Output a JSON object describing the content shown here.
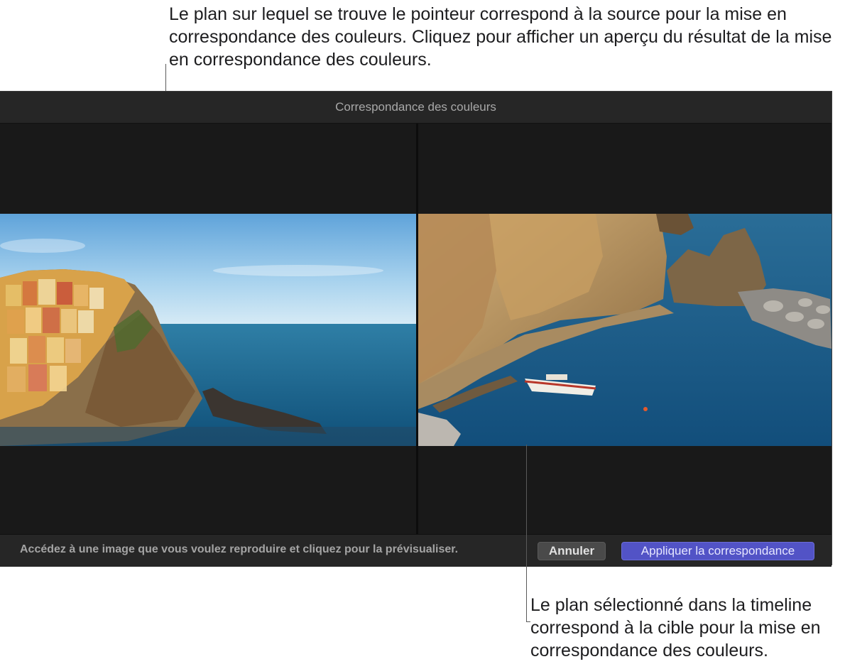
{
  "callouts": {
    "top": "Le plan sur lequel se trouve le pointeur correspond à la source pour la mise en correspondance des couleurs. Cliquez pour afficher un aperçu du résultat de la mise en correspondance des couleurs.",
    "bottom": "Le plan sélectionné dans la timeline correspond à la cible pour la mise en correspondance des couleurs."
  },
  "window": {
    "title": "Correspondance des couleurs"
  },
  "viewers": {
    "left": {
      "image": "coastal-village-photo"
    },
    "right": {
      "image": "harbor-boat-photo"
    }
  },
  "footer": {
    "hint": "Accédez à une image que vous voulez reproduire et cliquez pour la prévisualiser.",
    "cancel_label": "Annuler",
    "apply_label": "Appliquer la correspondance"
  },
  "colors": {
    "apply_button": "#5253c6",
    "window_background": "#1b1b1b"
  }
}
